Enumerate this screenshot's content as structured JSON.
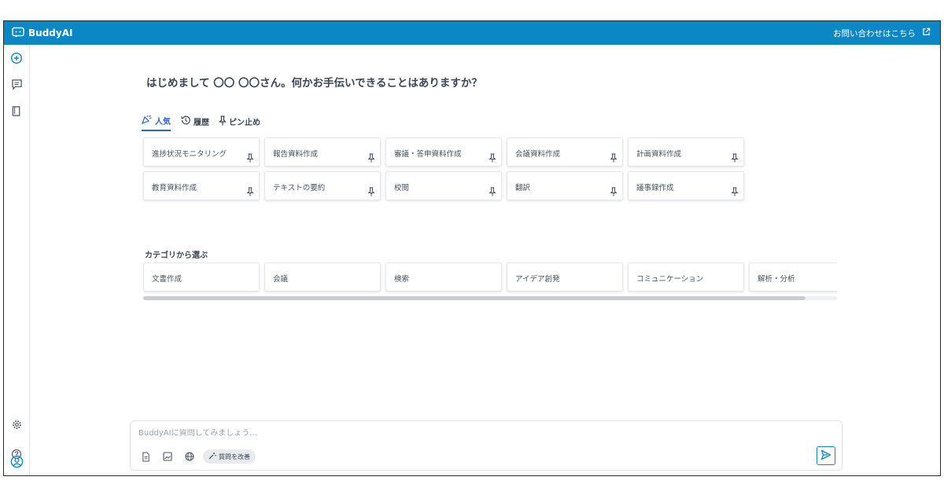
{
  "app": {
    "name": "BuddyAI"
  },
  "header": {
    "contact_label": "お問い合わせはこちら"
  },
  "sidebar": {
    "icons": [
      "new-chat-icon",
      "chat-history-icon",
      "book-icon",
      "settings-icon",
      "help-icon",
      "user-icon"
    ]
  },
  "greeting": "はじめまして 〇〇 〇〇さん。何かお手伝いできることはありますか？",
  "tabs": [
    {
      "label": "人気",
      "icon": "party-icon",
      "active": true
    },
    {
      "label": "履歴",
      "icon": "history-icon",
      "active": false
    },
    {
      "label": "ピン止め",
      "icon": "pin-icon",
      "active": false
    }
  ],
  "prompt_cards": [
    {
      "label": "進捗状況モニタリング"
    },
    {
      "label": "報告資料作成"
    },
    {
      "label": "審議・答申資料作成"
    },
    {
      "label": "会議資料作成"
    },
    {
      "label": "計画資料作成"
    },
    {
      "label": "教育資料作成"
    },
    {
      "label": "テキストの要約"
    },
    {
      "label": "校閲"
    },
    {
      "label": "翻訳"
    },
    {
      "label": "議事録作成"
    }
  ],
  "categories": {
    "title": "カテゴリから選ぶ",
    "items": [
      "文書作成",
      "会議",
      "検索",
      "アイデア創発",
      "コミュニケーション",
      "解析・分析"
    ]
  },
  "chat": {
    "placeholder": "BuddyAIに質問してみましょう...",
    "improve_label": "質問を改善"
  },
  "colors": {
    "brand": "#0b87c6",
    "accent": "#2b63d9"
  }
}
